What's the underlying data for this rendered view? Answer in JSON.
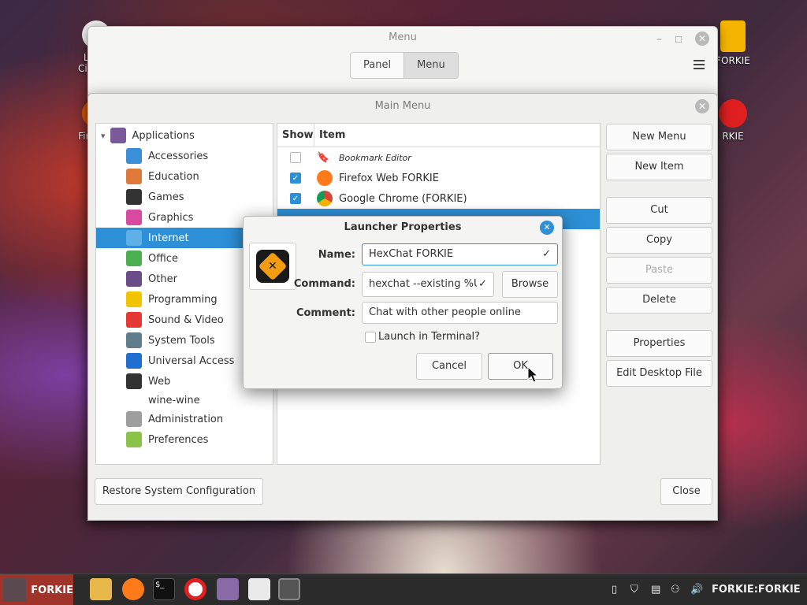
{
  "desktop": {
    "icons": [
      {
        "label": "Linux Cinnam"
      },
      {
        "label": "Firef FO"
      },
      {
        "label": "FORKIE"
      },
      {
        "label": "RKIE"
      }
    ]
  },
  "menu_window": {
    "title": "Menu",
    "tabs": [
      "Panel",
      "Menu"
    ],
    "active_tab": "Menu"
  },
  "main_menu": {
    "title": "Main Menu",
    "categories": [
      {
        "label": "Applications",
        "icon": "applications-grid-icon",
        "color": "#7a5a9a"
      },
      {
        "label": "Accessories",
        "icon": "scissors-icon",
        "color": "#3a8fd8"
      },
      {
        "label": "Education",
        "icon": "education-icon",
        "color": "#e07a3a"
      },
      {
        "label": "Games",
        "icon": "gamepad-icon",
        "color": "#333333"
      },
      {
        "label": "Graphics",
        "icon": "graphics-icon",
        "color": "#d84aa0"
      },
      {
        "label": "Internet",
        "icon": "cloud-icon",
        "color": "#5fb0e8"
      },
      {
        "label": "Office",
        "icon": "office-icon",
        "color": "#4caf50"
      },
      {
        "label": "Other",
        "icon": "other-grid-icon",
        "color": "#6a4d86"
      },
      {
        "label": "Programming",
        "icon": "programming-icon",
        "color": "#f2c400"
      },
      {
        "label": "Sound & Video",
        "icon": "play-icon",
        "color": "#e53935"
      },
      {
        "label": "System Tools",
        "icon": "gear-icon",
        "color": "#607d8b"
      },
      {
        "label": "Universal Access",
        "icon": "accessibility-icon",
        "color": "#1e6fd0"
      },
      {
        "label": "Web",
        "icon": "web-icon",
        "color": "#333333"
      },
      {
        "label": "wine-wine",
        "icon": "",
        "color": ""
      },
      {
        "label": "Administration",
        "icon": "toggle-icon",
        "color": "#9e9e9e"
      },
      {
        "label": "Preferences",
        "icon": "toggle-icon",
        "color": "#8bc34a"
      }
    ],
    "selected_category": "Internet",
    "columns": {
      "show": "Show",
      "item": "Item"
    },
    "items": [
      {
        "label": "Bookmark Editor",
        "checked": false,
        "icon": "bookmark-icon"
      },
      {
        "label": "Firefox Web FORKIE",
        "checked": true,
        "icon": "firefox-icon"
      },
      {
        "label": "Google Chrome (FORKIE)",
        "checked": true,
        "icon": "chrome-icon"
      }
    ],
    "buttons": {
      "new_menu": "New Menu",
      "new_item": "New Item",
      "cut": "Cut",
      "copy": "Copy",
      "paste": "Paste",
      "delete": "Delete",
      "properties": "Properties",
      "edit_desktop_file": "Edit Desktop File",
      "restore": "Restore System Configuration",
      "close": "Close"
    }
  },
  "launcher": {
    "title": "Launcher Properties",
    "name_label": "Name:",
    "name_value": "HexChat FORKIE",
    "command_label": "Command:",
    "command_value": "hexchat --existing %U",
    "browse": "Browse",
    "comment_label": "Comment:",
    "comment_value": "Chat with other people online",
    "terminal_label": "Launch in Terminal?",
    "cancel": "Cancel",
    "ok": "OK"
  },
  "taskbar": {
    "start_label": "FORKIE",
    "user": "FORKIE:FORKIE"
  }
}
